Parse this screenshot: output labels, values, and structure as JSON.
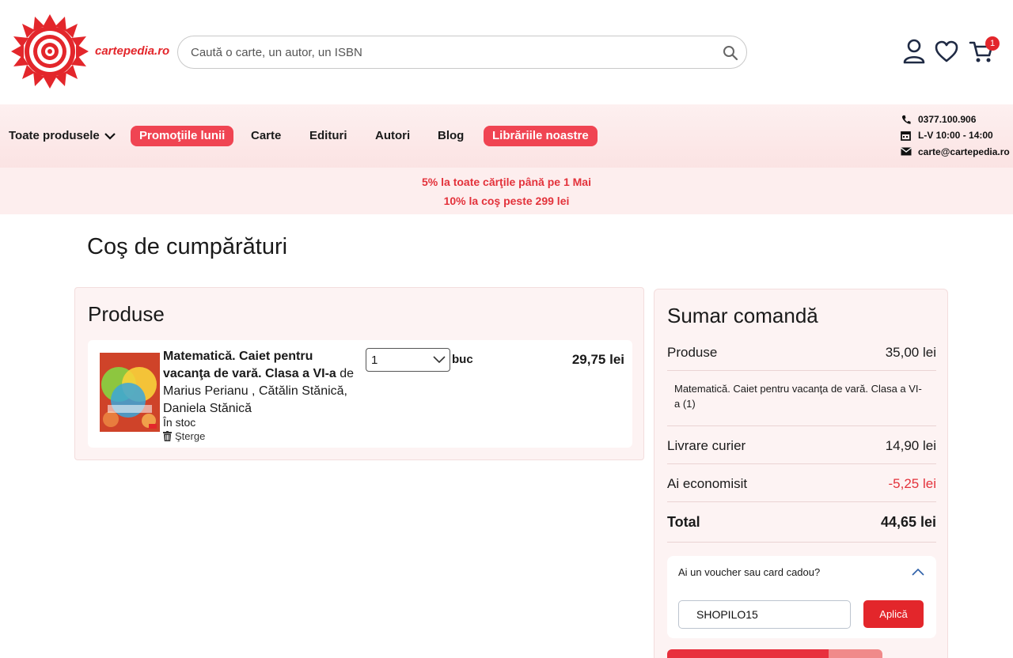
{
  "header": {
    "brand": "cartepedia.ro",
    "search_placeholder": "Caută o carte, un autor, un ISBN",
    "cart_count": "1"
  },
  "nav": {
    "all_products": "Toate produsele",
    "items": [
      "Promoţiile lunii",
      "Carte",
      "Edituri",
      "Autori",
      "Blog",
      "Librăriile noastre"
    ]
  },
  "contact": {
    "phone": "0377.100.906",
    "hours": "L-V 10:00 - 14:00",
    "email": "carte@cartepedia.ro"
  },
  "promo": {
    "line1": "5% la toate cărţile până pe 1 Mai",
    "line2": "10% la coş peste 299 lei"
  },
  "page_title": "Coş de cumpărături",
  "products": {
    "heading": "Produse",
    "item": {
      "title": "Matematică. Caiet pentru vacanţa de vară. Clasa a VI-a",
      "by": "de",
      "authors": "Marius Perianu , Cătălin Stănică, Daniela Stănică",
      "stock": "În stoc",
      "delete_label": "Şterge",
      "qty": "1",
      "unit": "buc",
      "price": "29,75 lei"
    }
  },
  "summary": {
    "heading": "Sumar comandă",
    "products_label": "Produse",
    "products_value": "35,00 lei",
    "item_line": "Matematică. Caiet pentru vacanţa de vară. Clasa a VI-a  (1)",
    "delivery_label": "Livrare curier",
    "delivery_value": "14,90 lei",
    "saved_label": "Ai economisit",
    "saved_value": "-5,25 lei",
    "total_label": "Total",
    "total_value": "44,65 lei",
    "voucher_question": "Ai un voucher sau card cadou?",
    "voucher_value": "SHOPILO15",
    "apply_label": "Aplică"
  },
  "colors": {
    "accent": "#e3262b",
    "pill": "#f04452",
    "panel_bg": "#fdf3f3"
  }
}
